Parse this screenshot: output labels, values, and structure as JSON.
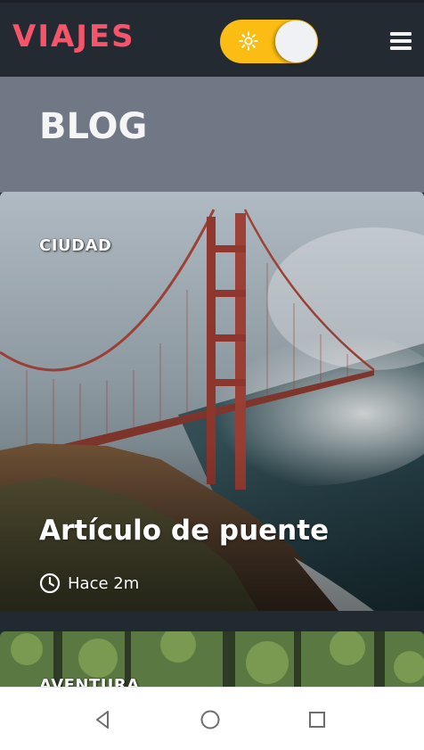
{
  "app": {
    "brand": "VIAJES"
  },
  "header": {
    "theme_toggle": {
      "icon": "sun-icon",
      "state": "light",
      "track_color": "#fbbd14"
    },
    "menu_icon": "hamburger-menu-icon"
  },
  "blog": {
    "title": "BLOG"
  },
  "posts": [
    {
      "category": "CIUDAD",
      "title": "Artículo de puente",
      "time": "Hace 2m",
      "time_icon": "clock-icon"
    },
    {
      "category": "AVENTURA"
    }
  ],
  "colors": {
    "brand": "#f5546b",
    "appbar": "#232a31",
    "band": "#707885",
    "toggle": "#fbbd14"
  },
  "system_nav": {
    "back": "back-icon",
    "home": "home-icon",
    "recents": "recents-icon"
  }
}
